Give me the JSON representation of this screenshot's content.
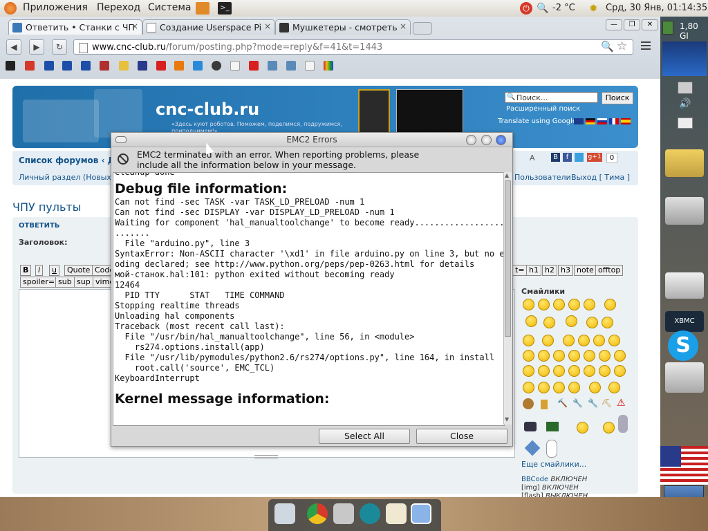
{
  "top_panel": {
    "menu": [
      "Приложения",
      "Переход",
      "Система"
    ],
    "weather": "-2 °C",
    "clock": "Срд, 30 Янв, 01:14:35"
  },
  "browser": {
    "tabs": [
      {
        "label": "Ответить • Станки с ЧП"
      },
      {
        "label": "Создание Userspace Pi"
      },
      {
        "label": "Мушкетеры - смотреть"
      }
    ],
    "url_host": "www.cnc-club.ru",
    "url_path": "/forum/posting.php?mode=reply&f=41&t=1443"
  },
  "side_indicator": {
    "disk": "1,80 GI"
  },
  "forum": {
    "site_name": "cnc-club.ru",
    "slogan": "«Здесь куют роботов. Поможем, поделимся, подружимся, приподнимем!»",
    "search_placeholder": "Поиск...",
    "search_button": "Поиск",
    "advanced_search": "Расширенный поиск",
    "translate": "Translate using Google:",
    "nav_forums": "Список форумов ‹ Де",
    "personal": "Личный раздел (Новых",
    "users": "Пользователи",
    "logout": "Выход [ Тима ]",
    "share_count": "0",
    "topic_title": "ЧПУ пульты",
    "reply_tab": "ОТВЕТИТЬ",
    "subject_label": "Заголовок:",
    "bbcode_row1": [
      "B",
      "i",
      "u",
      "Quote",
      "Code"
    ],
    "bbcode_row1_right": [
      "t=",
      "h1",
      "h2",
      "h3",
      "note",
      "offtop"
    ],
    "bbcode_row2": [
      "spoiler=",
      "sub",
      "sup",
      "vime"
    ],
    "smilies_title": "Смайлики",
    "more_smilies": "Еще смайлики...",
    "bbcode_status": "BBCode",
    "bbcode_on": "ВКЛЮЧЕН",
    "img_status": "[img]",
    "img_on": "ВКЛЮЧЕН",
    "flash_status": "[flash]",
    "flash_off": "ВЫКЛЮЧЕН"
  },
  "dialog": {
    "title": "EMC2 Errors",
    "message_line1": "EMC2 terminated with an error.  When reporting problems, please",
    "message_line2": "include all the information below in your message.",
    "log_top": "Cleanup done",
    "debug_header": "Debug file information:",
    "debug_lines": "Can not find -sec TASK -var TASK_LD_PRELOAD -num 1\nCan not find -sec DISPLAY -var DISPLAY_LD_PRELOAD -num 1\nWaiting for component 'hal_manualtoolchange' to become ready....................\n.......\n  File \"arduino.py\", line 3\nSyntaxError: Non-ASCII character '\\xd1' in file arduino.py on line 3, but no enc\noding declared; see http://www.python.org/peps/pep-0263.html for details\nмой-станок.hal:101: python exited without becoming ready\n12464\n  PID TTY      STAT   TIME COMMAND\nStopping realtime threads\nUnloading hal components\nTraceback (most recent call last):\n  File \"/usr/bin/hal_manualtoolchange\", line 56, in <module>\n    rs274.options.install(app)\n  File \"/usr/lib/pymodules/python2.6/rs274/options.py\", line 164, in install\n    root.call('source', EMC_TCL)\nKeyboardInterrupt",
    "kernel_header": "Kernel message information:",
    "select_all": "Select All",
    "close": "Close"
  }
}
